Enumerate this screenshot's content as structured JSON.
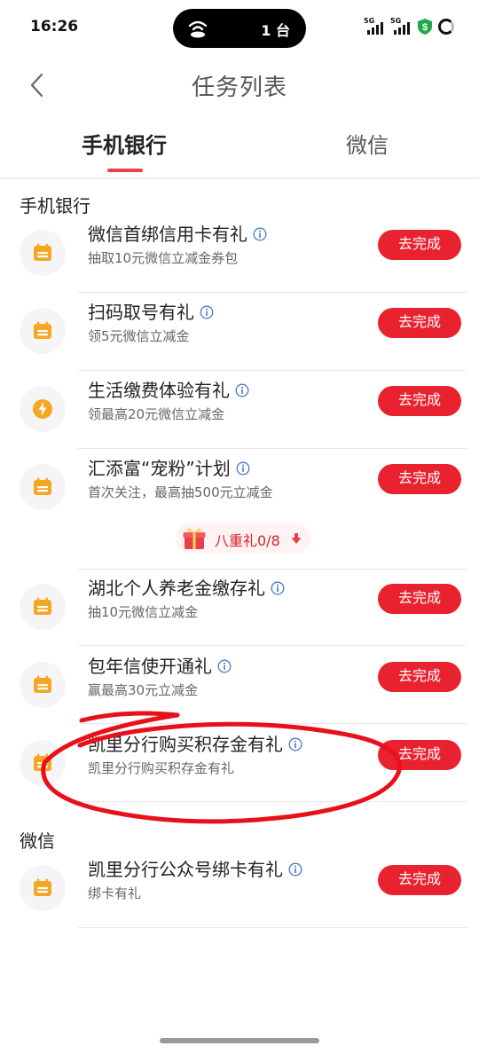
{
  "status_bar": {
    "time": "16:26",
    "island_text": "1 台",
    "sig1": "5G",
    "sig2": "5G",
    "shield_symbol": "$"
  },
  "header": {
    "title": "任务列表"
  },
  "tabs": {
    "active": "手机银行",
    "inactive": "微信"
  },
  "sections": {
    "bank": "手机银行",
    "wechat": "微信"
  },
  "tasks": [
    {
      "title": "微信首绑信用卡有礼",
      "sub": "抽取10元微信立减金券包",
      "icon": "calendar-icon",
      "button": "去完成"
    },
    {
      "title": "扫码取号有礼",
      "sub": "领5元微信立减金",
      "icon": "calendar-icon",
      "button": "去完成"
    },
    {
      "title": "生活缴费体验有礼",
      "sub": "领最高20元微信立减金",
      "icon": "lightning-icon",
      "button": "去完成"
    },
    {
      "title": "汇添富“宠粉”计划",
      "sub": "首次关注，最高抽500元立减金",
      "icon": "calendar-icon",
      "button": "去完成"
    },
    {
      "title": "湖北个人养老金缴存礼",
      "sub": "抽10元微信立减金",
      "icon": "calendar-icon",
      "button": "去完成"
    },
    {
      "title": "包年信使开通礼",
      "sub": "赢最高30元立减金",
      "icon": "calendar-icon",
      "button": "去完成"
    },
    {
      "title": "凯里分行购买积存金有礼",
      "sub": "凯里分行购买积存金有礼",
      "icon": "calendar-icon",
      "button": "去完成"
    },
    {
      "title": "凯里分行公众号绑卡有礼",
      "sub": "绑卡有礼",
      "icon": "calendar-icon",
      "button": "去完成"
    }
  ],
  "eight_gift": {
    "label": "八重礼0/8",
    "progress_done": 0,
    "progress_total": 8
  },
  "colors": {
    "accent": "#e8222e",
    "icon_orange": "#f5a623",
    "annotation_red": "#e8101a"
  }
}
